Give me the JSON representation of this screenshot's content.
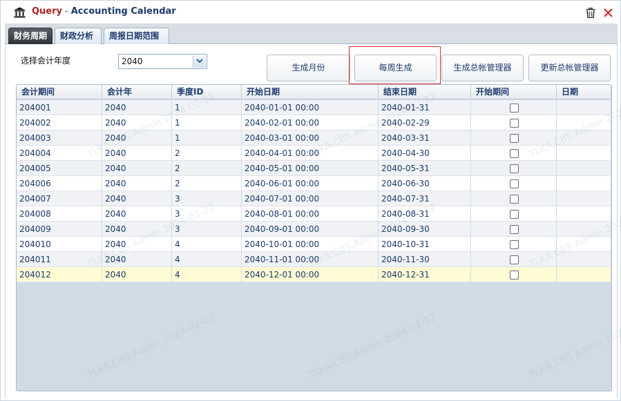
{
  "window": {
    "title_prefix": "Query",
    "title_separator": "-",
    "title": "Accounting Calendar"
  },
  "icons": {
    "app": "bank-building-icon",
    "delete": "trash-icon",
    "close": "close-icon"
  },
  "tabs": [
    {
      "label": "财务周期",
      "active": true
    },
    {
      "label": "财政分析",
      "active": false
    },
    {
      "label": "周报日期范围",
      "active": false
    }
  ],
  "filter": {
    "year_label": "选择会计年度",
    "year_value": "2040"
  },
  "buttons": {
    "generate_month": "生成月份",
    "weekly_generate": "每周生成",
    "generate_gl_manager": "生成总帐管理器",
    "update_gl_manager": "更新总帐管理器"
  },
  "table": {
    "columns": [
      "会计期间",
      "会计年",
      "季度ID",
      "开始日期",
      "结束日期",
      "开始期间",
      "日期"
    ],
    "rows": [
      {
        "period": "204001",
        "year": "2040",
        "quarter": "1",
        "start": "2040-01-01 00:00",
        "end": "2040-01-31",
        "start_period": false,
        "date": ""
      },
      {
        "period": "204002",
        "year": "2040",
        "quarter": "1",
        "start": "2040-02-01 00:00",
        "end": "2040-02-29",
        "start_period": false,
        "date": ""
      },
      {
        "period": "204003",
        "year": "2040",
        "quarter": "1",
        "start": "2040-03-01 00:00",
        "end": "2040-03-31",
        "start_period": false,
        "date": ""
      },
      {
        "period": "204004",
        "year": "2040",
        "quarter": "2",
        "start": "2040-04-01 00:00",
        "end": "2040-04-30",
        "start_period": false,
        "date": ""
      },
      {
        "period": "204005",
        "year": "2040",
        "quarter": "2",
        "start": "2040-05-01 00:00",
        "end": "2040-05-31",
        "start_period": false,
        "date": ""
      },
      {
        "period": "204006",
        "year": "2040",
        "quarter": "2",
        "start": "2040-06-01 00:00",
        "end": "2040-06-30",
        "start_period": false,
        "date": ""
      },
      {
        "period": "204007",
        "year": "2040",
        "quarter": "3",
        "start": "2040-07-01 00:00",
        "end": "2040-07-31",
        "start_period": false,
        "date": ""
      },
      {
        "period": "204008",
        "year": "2040",
        "quarter": "3",
        "start": "2040-08-01 00:00",
        "end": "2040-08-31",
        "start_period": false,
        "date": ""
      },
      {
        "period": "204009",
        "year": "2040",
        "quarter": "3",
        "start": "2040-09-01 00:00",
        "end": "2040-09-30",
        "start_period": false,
        "date": ""
      },
      {
        "period": "204010",
        "year": "2040",
        "quarter": "4",
        "start": "2040-10-01 00:00",
        "end": "2040-10-31",
        "start_period": false,
        "date": ""
      },
      {
        "period": "204011",
        "year": "2040",
        "quarter": "4",
        "start": "2040-11-01 00:00",
        "end": "2040-11-30",
        "start_period": false,
        "date": ""
      },
      {
        "period": "204012",
        "year": "2040",
        "quarter": "4",
        "start": "2040-12-01 00:00",
        "end": "2040-12-31",
        "start_period": false,
        "date": "",
        "selected": true
      }
    ]
  },
  "watermark": "TLKA.CBS.Admin 2024-02-22",
  "colors": {
    "title_accent": "#b22222",
    "text_primary": "#1e3a6e",
    "selected_row": "#fffbd4",
    "highlight_border": "#e02b2b"
  }
}
